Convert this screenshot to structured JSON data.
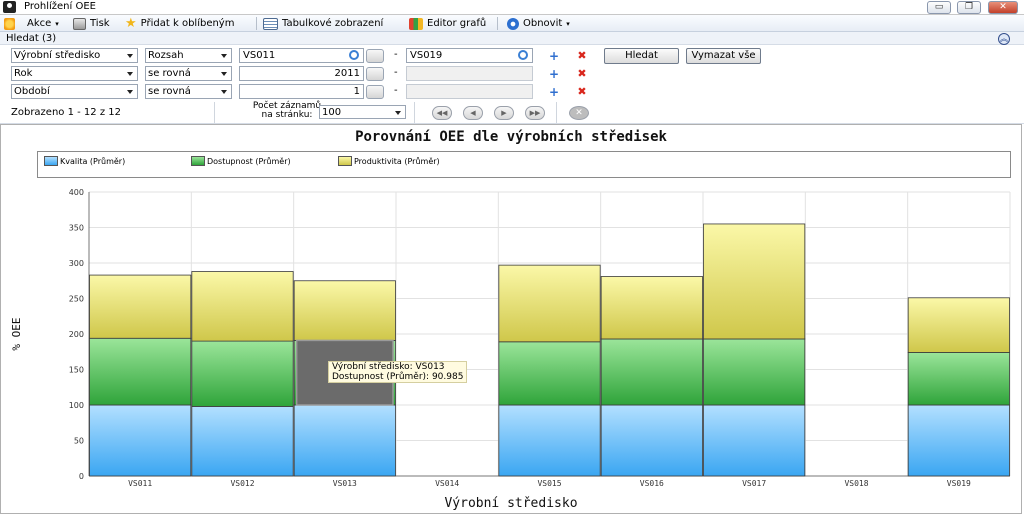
{
  "window": {
    "title": "Prohlížení OEE",
    "minimize": "▭",
    "restore": "❐",
    "close": "✕"
  },
  "toolbar": {
    "akce": "Akce",
    "tisk": "Tisk",
    "oblibene": "Přidat k oblíbeným",
    "tabulka": "Tabulkové zobrazení",
    "editor": "Editor grafů",
    "obnovit": "Obnovit"
  },
  "filter": {
    "header": "Hledat (3)",
    "rows": [
      {
        "field": "Výrobní středisko",
        "op": "Rozsah",
        "v1": "VS011",
        "v2": "VS019"
      },
      {
        "field": "Rok",
        "op": "se rovná",
        "v1": "2011",
        "v2": ""
      },
      {
        "field": "Období",
        "op": "se rovná",
        "v1": "1",
        "v2": ""
      }
    ],
    "dash": "-",
    "search_button": "Hledat",
    "clear_button": "Vymazat vše"
  },
  "pager": {
    "status": "Zobrazeno 1 - 12 z 12",
    "label_line1": "Počet záznamů",
    "label_line2": "na stránku:",
    "per_page": "100"
  },
  "colors": {
    "kvalita": "#3aa6f2",
    "dostupnost": "#2fa43a",
    "produktivita": "#cfc74a"
  },
  "tooltip": {
    "line1": "Výrobní středisko: VS013",
    "line2": "Dostupnost (Průměr): 90.985"
  },
  "chart_data": {
    "type": "bar",
    "stacked": true,
    "title": "Porovnání OEE dle výrobních středisek",
    "xlabel": "Výrobní středisko",
    "ylabel": "% OEE",
    "ylim": [
      0,
      400
    ],
    "yticks": [
      0,
      50,
      100,
      150,
      200,
      250,
      300,
      350,
      400
    ],
    "grid": true,
    "legend_position": "top",
    "categories": [
      "VS011",
      "VS012",
      "VS013",
      "VS014",
      "VS015",
      "VS016",
      "VS017",
      "VS018",
      "VS019"
    ],
    "series": [
      {
        "name": "Kvalita (Průměr)",
        "values": [
          100,
          98,
          100,
          0,
          100,
          100,
          100,
          0,
          100
        ]
      },
      {
        "name": "Dostupnost (Průměr)",
        "values": [
          94,
          92,
          90.985,
          0,
          89,
          93,
          93,
          0,
          74
        ]
      },
      {
        "name": "Produktivita (Průměr)",
        "values": [
          89,
          98,
          84,
          0,
          108,
          88,
          162,
          0,
          77
        ]
      }
    ]
  }
}
